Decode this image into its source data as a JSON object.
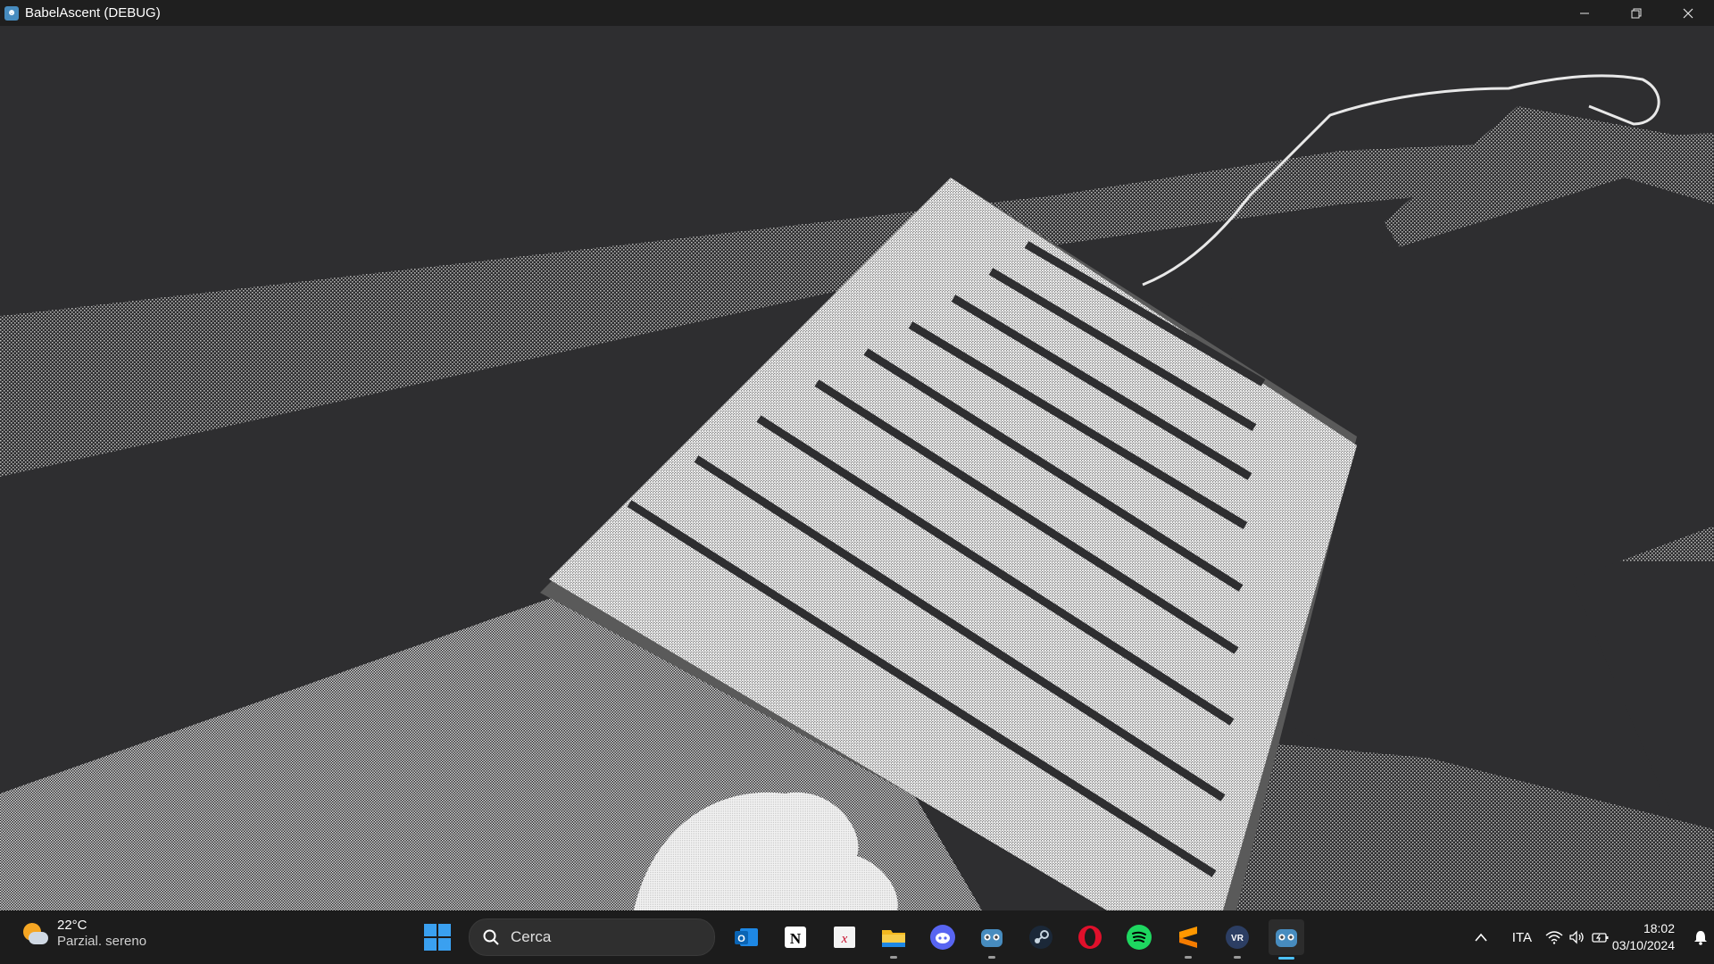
{
  "window": {
    "title": "BabelAscent (DEBUG)",
    "app_icon": "godot-icon",
    "controls": [
      "minimize-icon",
      "restore-icon",
      "close-icon"
    ]
  },
  "taskbar": {
    "weather": {
      "temperature": "22°C",
      "condition": "Parzial. sereno",
      "icon": "partly-cloudy-icon"
    },
    "search": {
      "placeholder": "Cerca"
    },
    "pinned_apps": [
      "outlook-icon",
      "notion-icon",
      "wolfram-icon",
      "file-explorer-icon",
      "discord-icon",
      "godot-icon",
      "steam-icon",
      "opera-icon",
      "spotify-icon",
      "sublime-icon",
      "vr-icon",
      "godot-debug-icon"
    ],
    "tray": {
      "language": "ITA",
      "time": "18:02",
      "date": "03/10/2024"
    }
  },
  "colors": {
    "titlebar": "#1f1f1f",
    "taskbar": "#1c1c1c",
    "viewport_dark": "#2e2e30",
    "dither_light": "#cfcfcf",
    "accent": "#4cc2ff"
  }
}
